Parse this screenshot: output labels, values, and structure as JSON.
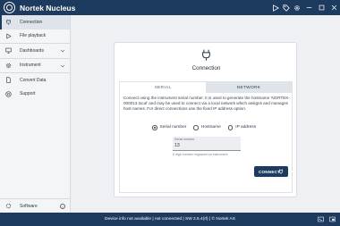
{
  "app": {
    "title": "Nortek Nucleus",
    "logo_text": "NORTEK"
  },
  "titlebar": {
    "icons": [
      "play-icon",
      "tag-icon",
      "gear-icon"
    ],
    "window_controls": [
      "minimize-icon",
      "maximize-icon",
      "close-icon"
    ]
  },
  "sidebar": {
    "items": [
      {
        "label": "Connection",
        "icon": "plug-icon",
        "active": true
      },
      {
        "label": "File playback",
        "icon": "play-icon"
      },
      {
        "label": "Dashboards",
        "icon": "monitor-icon",
        "expandable": true
      },
      {
        "label": "Instrument",
        "icon": "gear-icon",
        "expandable": true
      },
      {
        "label": "Convert Data",
        "icon": "document-icon"
      },
      {
        "label": "Support",
        "icon": "help-icon"
      }
    ],
    "footer": {
      "label": "Software",
      "icon": "settings-icon"
    }
  },
  "connection_card": {
    "title": "Connection",
    "tabs": [
      {
        "label": "SERIAL",
        "active": false
      },
      {
        "label": "NETWORK",
        "active": true
      }
    ],
    "description": "Connect using the instrument serial number. It is used to generate the hostname 'NORTEK-000013.local' and may be used to connect via a local network which assigns and manages host names. For direct connections use the fixed IP address option.",
    "options": [
      {
        "label": "Serial number",
        "selected": true
      },
      {
        "label": "Hostname",
        "selected": false
      },
      {
        "label": "IP address",
        "selected": false
      }
    ],
    "serial_field": {
      "label": "Serial number",
      "value": "13"
    },
    "hint": "6 digit number engraved on instrument",
    "connect_label": "CONNECT"
  },
  "statusbar": {
    "text": "Device info not available | not connected | SW 2.5.4(rl) | © Nortek AS",
    "icons": [
      "terminal-icon",
      "expand-icon"
    ]
  },
  "colors": {
    "primary": "#1d3a5f",
    "background": "#eef0f3",
    "sidebar": "#f4f5f7"
  }
}
